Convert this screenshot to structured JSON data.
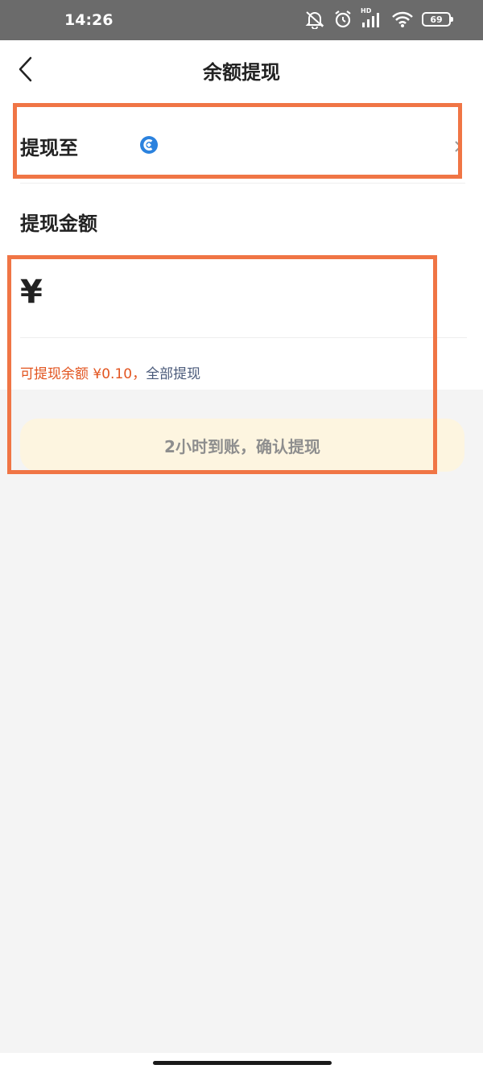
{
  "status_bar": {
    "time": "14:26",
    "signal_label": "HD",
    "battery_level": "69"
  },
  "navbar": {
    "title": "余额提现"
  },
  "withdraw_to": {
    "label": "提现至",
    "bank_icon": "bank-logo-icon",
    "chevron_icon": "chevron-right-icon"
  },
  "amount": {
    "label": "提现金额",
    "currency_symbol": "¥",
    "input_value": "",
    "balance_text": "可提现余额 ¥0.10，",
    "withdraw_all_label": "全部提现"
  },
  "confirm_button": {
    "label": "2小时到账，确认提现"
  },
  "colors": {
    "accent_orange": "#e2541f",
    "link_blue": "#4a5a7a",
    "highlight_border": "#f07545",
    "button_bg": "#fdf5e0"
  }
}
